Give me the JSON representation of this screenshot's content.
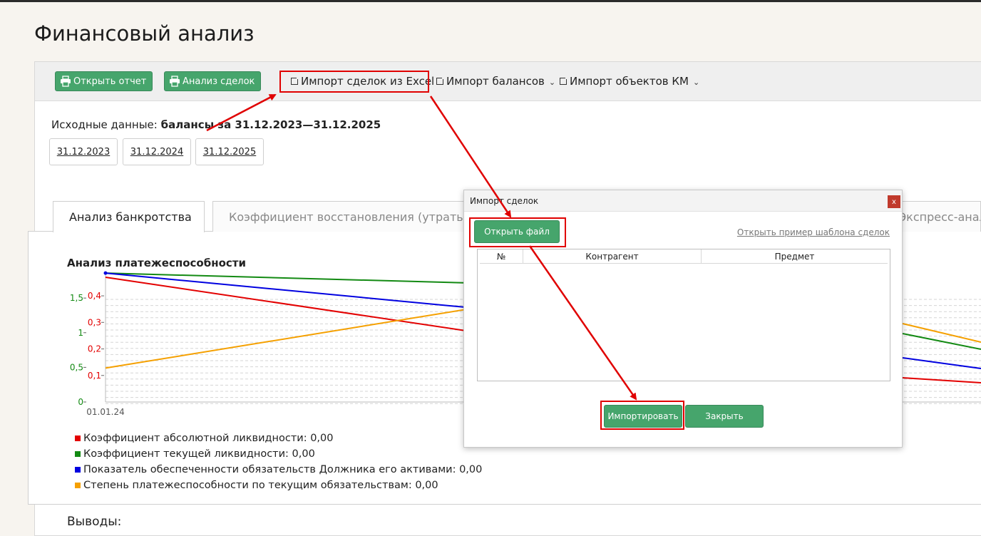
{
  "page": {
    "title": "Финансовый анализ"
  },
  "toolbar": {
    "open_report": "Открыть отчет",
    "deal_analysis": "Анализ сделок",
    "import_excel": "Импорт сделок из Excel",
    "import_balances": "Импорт балансов",
    "import_km": "Импорт объектов КМ"
  },
  "source": {
    "label": "Исходные данные:",
    "value": "балансы за 31.12.2023—31.12.2025",
    "dates": [
      "31.12.2023",
      "31.12.2024",
      "31.12.2025"
    ]
  },
  "tabs": [
    {
      "label": "Анализ банкротства",
      "active": true
    },
    {
      "label": "Коэффициент восстановления (утраты)",
      "active": false
    },
    {
      "label": "Экспресс-анали",
      "active": false
    }
  ],
  "chart_data": {
    "type": "line",
    "title": "Анализ платежеспособности",
    "x_first_label": "01.01.24",
    "left_axis_green": {
      "ticks": [
        "0",
        "0,5",
        "1",
        "1,5"
      ],
      "range": [
        0,
        1.8
      ]
    },
    "left_axis_red": {
      "ticks": [
        "0,1",
        "0,2",
        "0,3",
        "0,4"
      ],
      "range": [
        0,
        0.47
      ]
    },
    "series": [
      {
        "name": "Коэффициент абсолютной ликвидности",
        "color": "#e30000",
        "values": [
          0.47,
          0.27
        ]
      },
      {
        "name": "Коэффициент текущей ликвидности",
        "color": "#138a13",
        "values": [
          1.86,
          1.72
        ]
      },
      {
        "name": "Показатель обеспеченности обязательств Должника его активами",
        "color": "#0000e0",
        "values": [
          1.86,
          1.37
        ]
      },
      {
        "name": "Степень платежеспособности по текущим обязательствам",
        "color": "#f5a000",
        "values": [
          0.49,
          1.33
        ]
      }
    ],
    "right_tail_y": {
      "green": 490,
      "blue": 517,
      "orange": 480,
      "red": 537
    }
  },
  "legend": [
    {
      "label": "Коэффициент абсолютной ликвидности: 0,00",
      "color": "#e30000"
    },
    {
      "label": "Коэффициент текущей ликвидности: 0,00",
      "color": "#138a13"
    },
    {
      "label": "Показатель обеспеченности обязательств Должника его активами: 0,00",
      "color": "#0000e0"
    },
    {
      "label": "Степень платежеспособности по текущим обязательствам: 0,00",
      "color": "#f5a000"
    }
  ],
  "conclusions": {
    "label": "Выводы:"
  },
  "dialog": {
    "title": "Импорт сделок",
    "close": "x",
    "open_file": "Открыть файл",
    "template_link": "Открыть пример шаблона сделок",
    "columns": [
      "№",
      "Контрагент",
      "Предмет"
    ],
    "import": "Импортировать",
    "cancel": "Закрыть"
  }
}
